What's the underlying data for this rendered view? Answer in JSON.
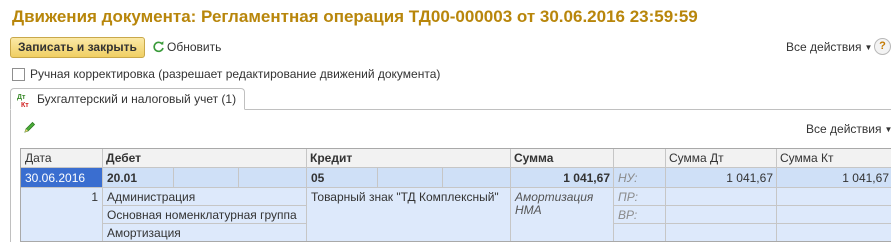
{
  "window": {
    "title": "Движения документа: Регламентная операция ТД00-000003 от 30.06.2016 23:59:59"
  },
  "toolbar": {
    "save_close_label": "Записать и закрыть",
    "refresh_label": "Обновить",
    "all_actions_label": "Все действия",
    "help_label": "?"
  },
  "manual_correction": {
    "label": "Ручная корректировка (разрешает редактирование движений документа)",
    "checked": false
  },
  "tabs": [
    {
      "label": "Бухгалтерский и налоговый учет (1)",
      "icon": "dt-kt-icon"
    }
  ],
  "panel": {
    "all_actions_label": "Все действия"
  },
  "table": {
    "columns": [
      "Дата",
      "Дебет",
      "Кредит",
      "Сумма",
      "",
      "Сумма Дт",
      "Сумма Кт"
    ],
    "row": {
      "date": "30.06.2016",
      "number": "1",
      "debit_account": "20.01",
      "debit_subconto": [
        "Администрация",
        "Основная номенклатурная группа",
        "Амортизация"
      ],
      "credit_account": "05",
      "credit_subconto": "Товарный знак \"ТД Комплексный\"",
      "sum": "1 041,67",
      "content_line1": "Амортизация",
      "content_line2": "НМА",
      "tax_labels": [
        "НУ:",
        "ПР:",
        "ВР:"
      ],
      "sum_dt": "1 041,67",
      "sum_kt": "1 041,67"
    }
  },
  "colors": {
    "title": "#b8860b",
    "selected_row": "#cfe0f7",
    "selected_cell": "#3a6ed0",
    "row_bg": "#dde9fb"
  }
}
